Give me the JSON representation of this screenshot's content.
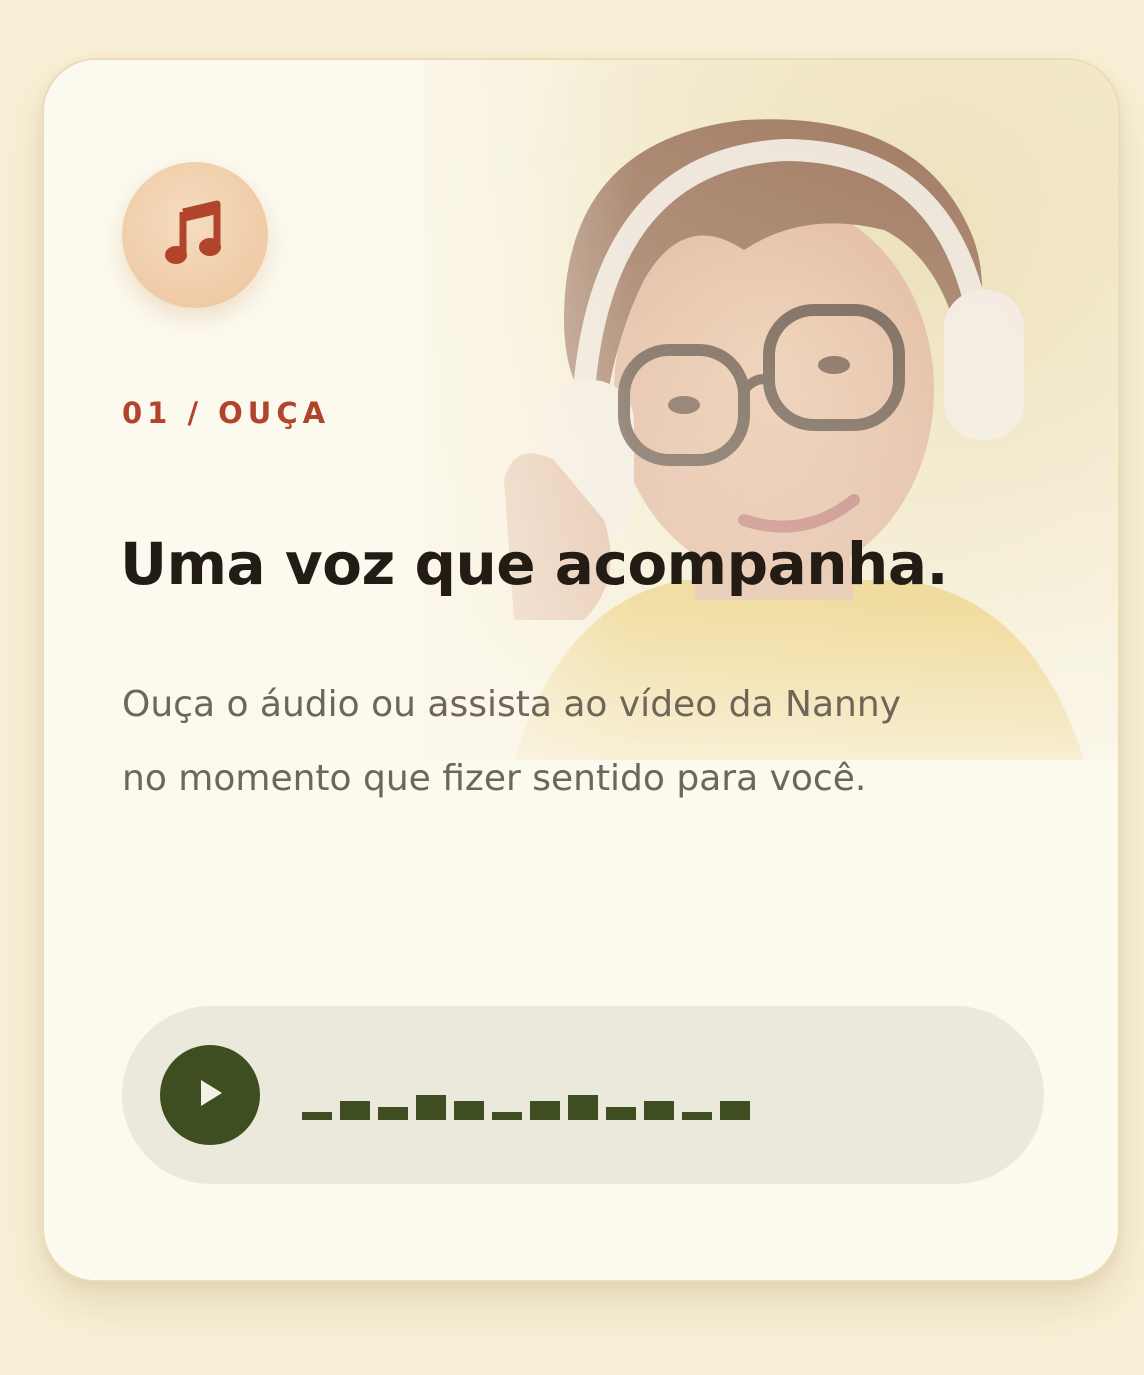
{
  "card": {
    "eyebrow": "01 / OUÇA",
    "title": "Uma voz que acompanha.",
    "description_lines": [
      "Ouça o áudio ou assista ao vídeo da Nanny",
      "no momento que fizer sentido para você."
    ],
    "badge_icon": "music-note-icon",
    "photo": "woman-with-headphones-photo"
  },
  "player": {
    "play_icon": "play-icon",
    "waveform_levels": [
      0.2,
      0.5,
      0.35,
      0.65,
      0.5,
      0.2,
      0.5,
      0.65,
      0.35,
      0.5,
      0.2,
      0.5
    ]
  },
  "colors": {
    "background": "#f8efd6",
    "card": "#fcf9ef",
    "accent_red": "#b0452c",
    "title": "#231c14",
    "body_text": "#6e6658",
    "player_bg": "#ebe9dc",
    "player_green": "#3e4e20",
    "badge": "#efcba6"
  }
}
